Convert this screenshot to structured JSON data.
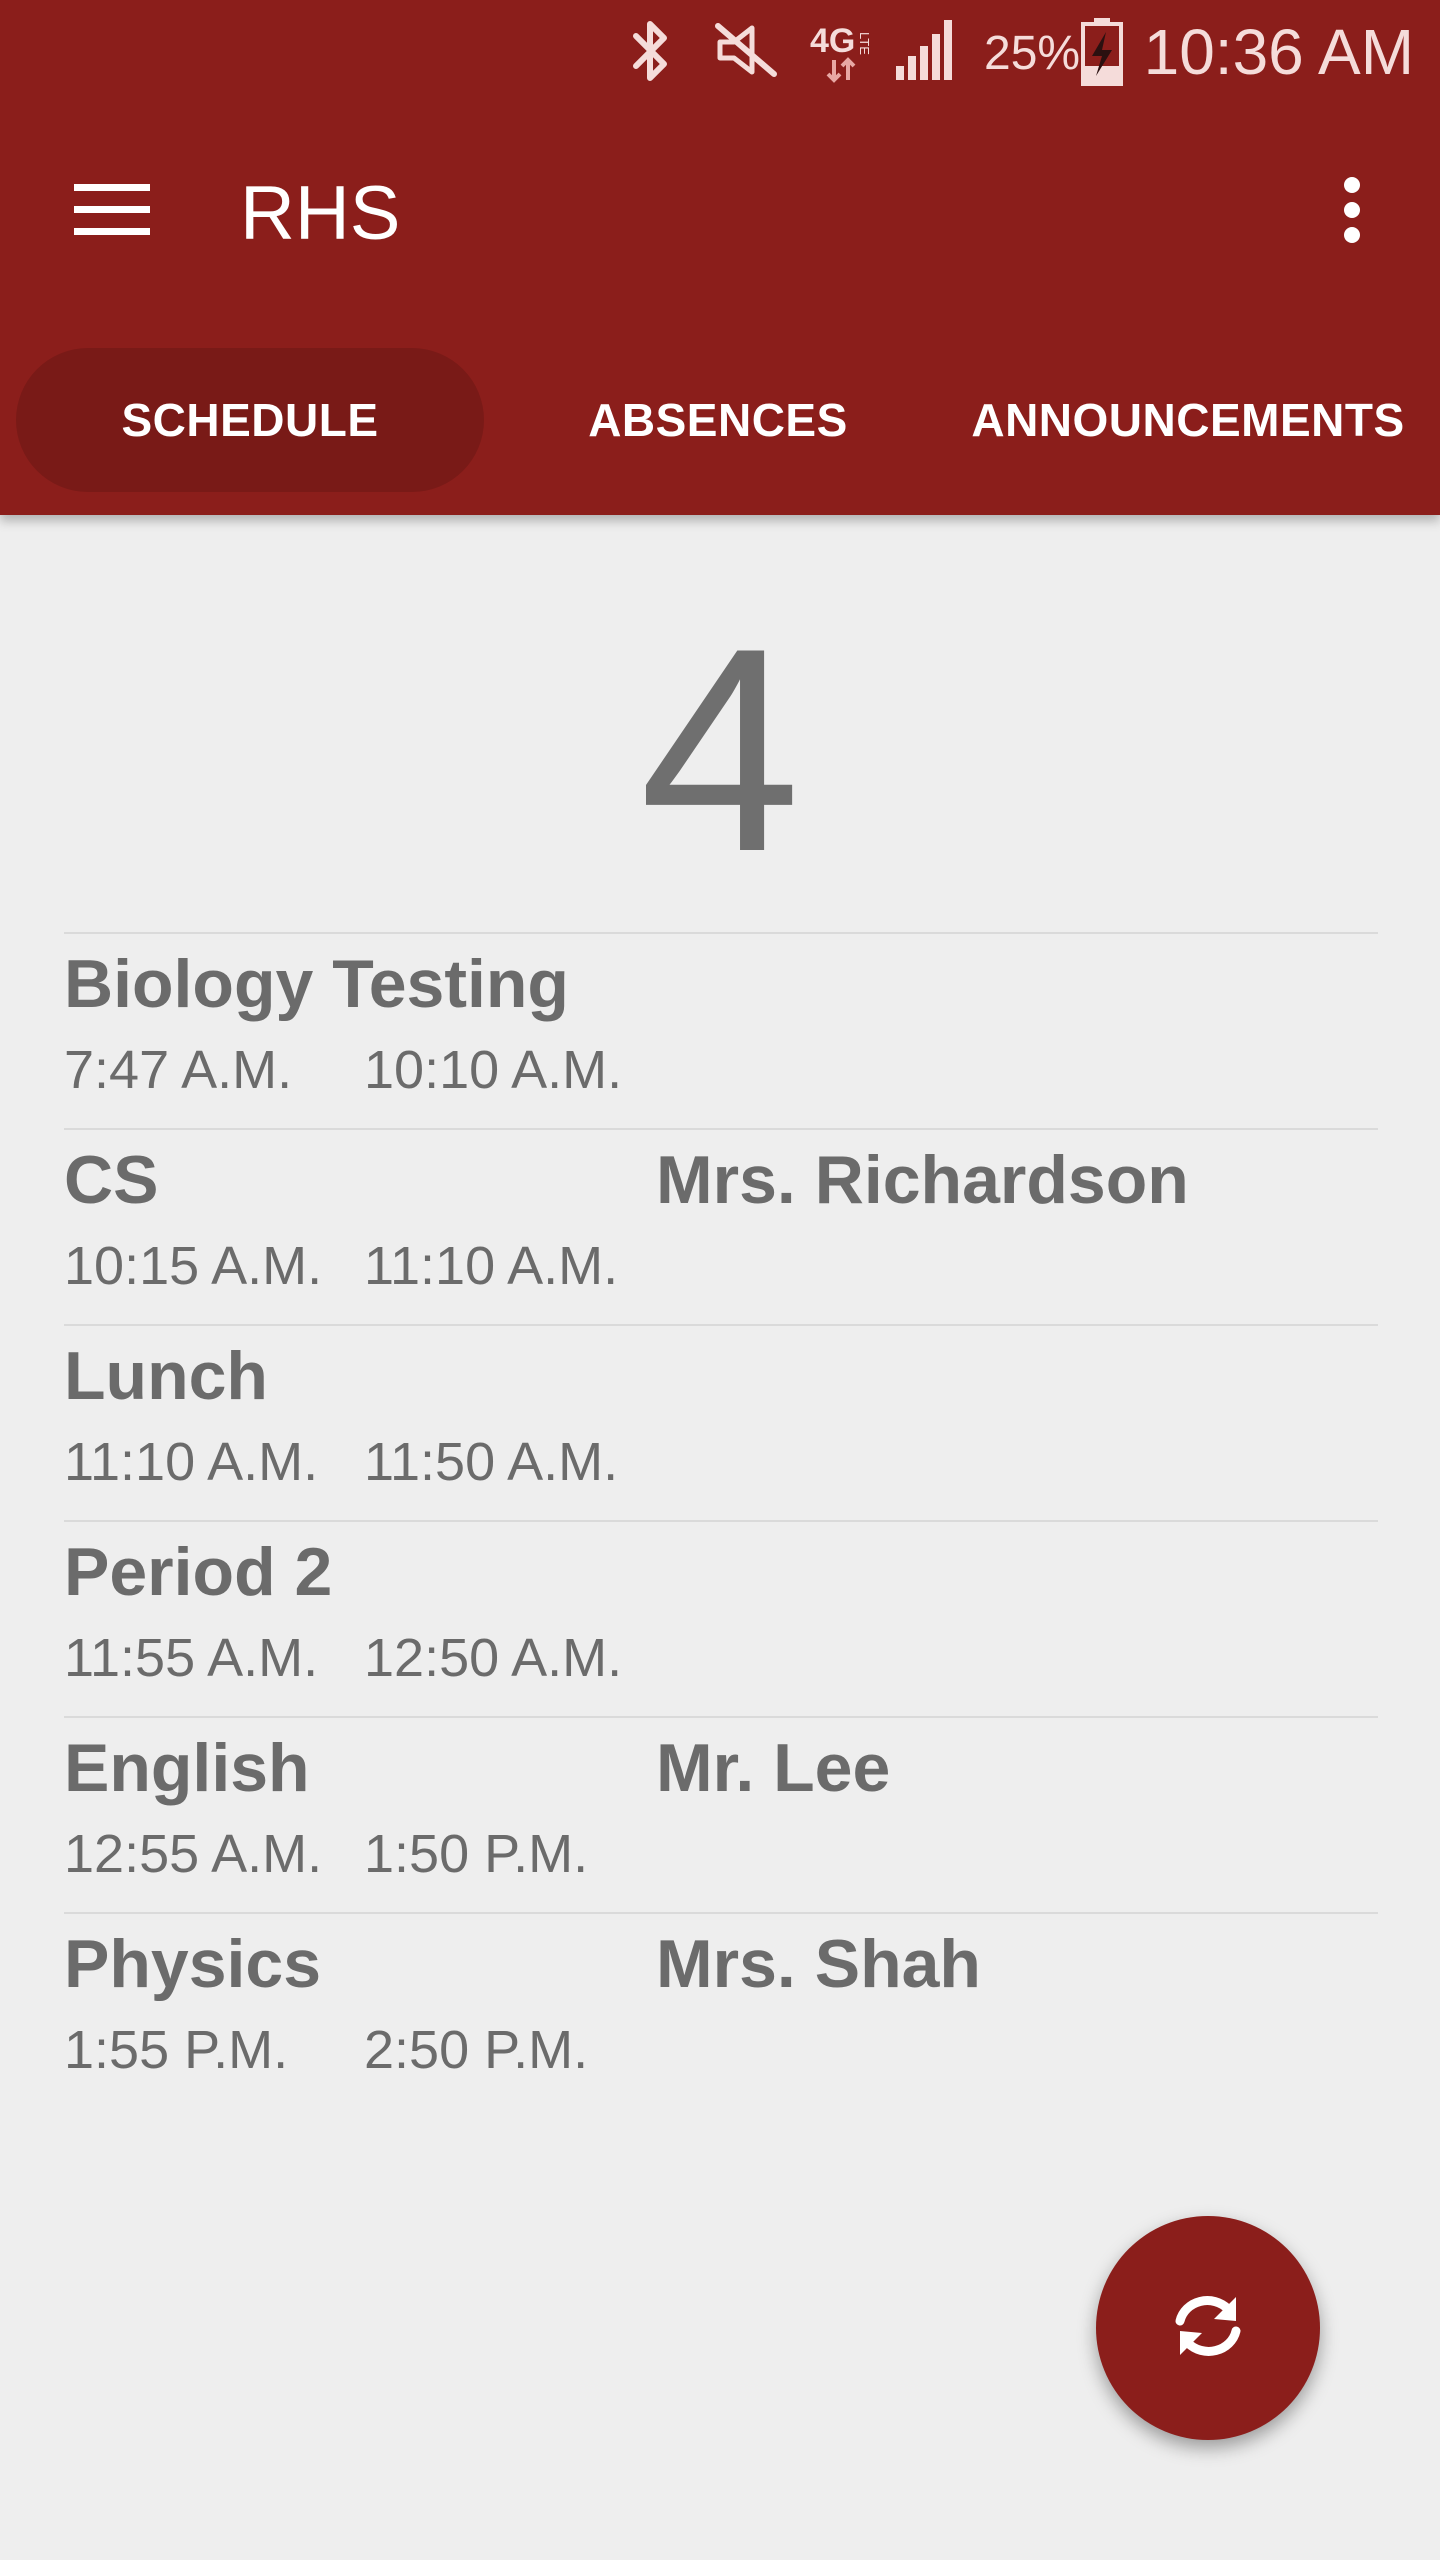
{
  "status_bar": {
    "time": "10:36 AM",
    "battery_percent": "25%",
    "network": "4G LTE",
    "icons": [
      "bluetooth-icon",
      "mute-icon",
      "network-4g-lte-icon",
      "signal-icon",
      "battery-charging-icon"
    ]
  },
  "toolbar": {
    "title": "RHS",
    "menu_icon": "menu-icon",
    "overflow_icon": "more-vert-icon"
  },
  "tabs": [
    {
      "label": "SCHEDULE",
      "active": true
    },
    {
      "label": "ABSENCES",
      "active": false
    },
    {
      "label": "ANNOUNCEMENTS",
      "active": false
    }
  ],
  "day_number": "4",
  "schedule": [
    {
      "class": "Biology Testing",
      "teacher": "",
      "start": "7:47 A.M.",
      "end": "10:10 A.M."
    },
    {
      "class": "CS",
      "teacher": "Mrs. Richardson",
      "start": "10:15 A.M.",
      "end": "11:10 A.M."
    },
    {
      "class": "Lunch",
      "teacher": "",
      "start": "11:10 A.M.",
      "end": "11:50 A.M."
    },
    {
      "class": "Period 2",
      "teacher": "",
      "start": "11:55 A.M.",
      "end": "12:50 A.M."
    },
    {
      "class": "English",
      "teacher": "Mr. Lee",
      "start": "12:55 A.M.",
      "end": "1:50 P.M."
    },
    {
      "class": "Physics",
      "teacher": "Mrs. Shah",
      "start": "1:55 P.M.",
      "end": "2:50 P.M."
    }
  ],
  "fab": {
    "icon": "refresh-icon"
  },
  "colors": {
    "primary": "#8b1e1b",
    "tab_active": "#791a17",
    "background": "#eeeeee",
    "text": "#6b6b6b"
  }
}
